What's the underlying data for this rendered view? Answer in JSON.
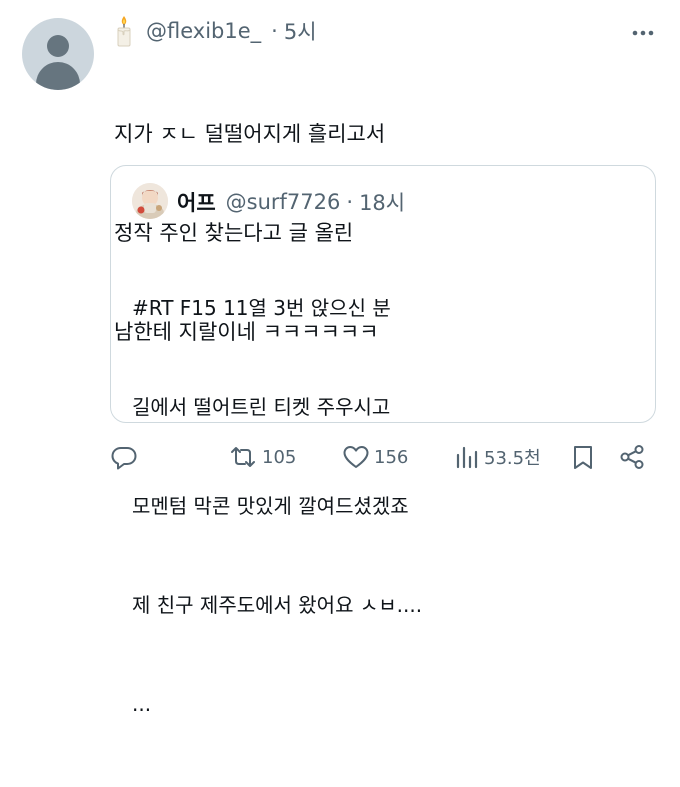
{
  "tweet": {
    "author_emoji_icon": "candle-icon",
    "handle": "@flexib1e_",
    "separator": "·",
    "time": "5시",
    "lines": [
      "지가 ㅈㄴ 덜떨어지게 흘리고서",
      "정작 주인 찾는다고 글 올린",
      "남한테 지랄이네 ㅋㅋㅋㅋㅋㅋ"
    ]
  },
  "quote": {
    "name": "어프",
    "handle": "@surf7726",
    "separator": "·",
    "time": "18시",
    "lines": [
      "#RT F15 11열 3번 앉으신 분",
      "길에서 떨어트린 티켓 주우시고",
      "모멘텀 막콘 맛있게 깔여드셨겠죠",
      "제 친구 제주도에서 왔어요 ㅅㅂ....",
      "..."
    ]
  },
  "actions": {
    "reply_icon": "reply-icon",
    "retweet_icon": "retweet-icon",
    "retweets": "105",
    "like_icon": "heart-icon",
    "likes": "156",
    "views_icon": "views-icon",
    "views": "53.5천",
    "bookmark_icon": "bookmark-icon",
    "share_icon": "share-icon"
  },
  "colors": {
    "text": "#0f1419",
    "secondary": "#536471",
    "border": "#cfd9de"
  }
}
